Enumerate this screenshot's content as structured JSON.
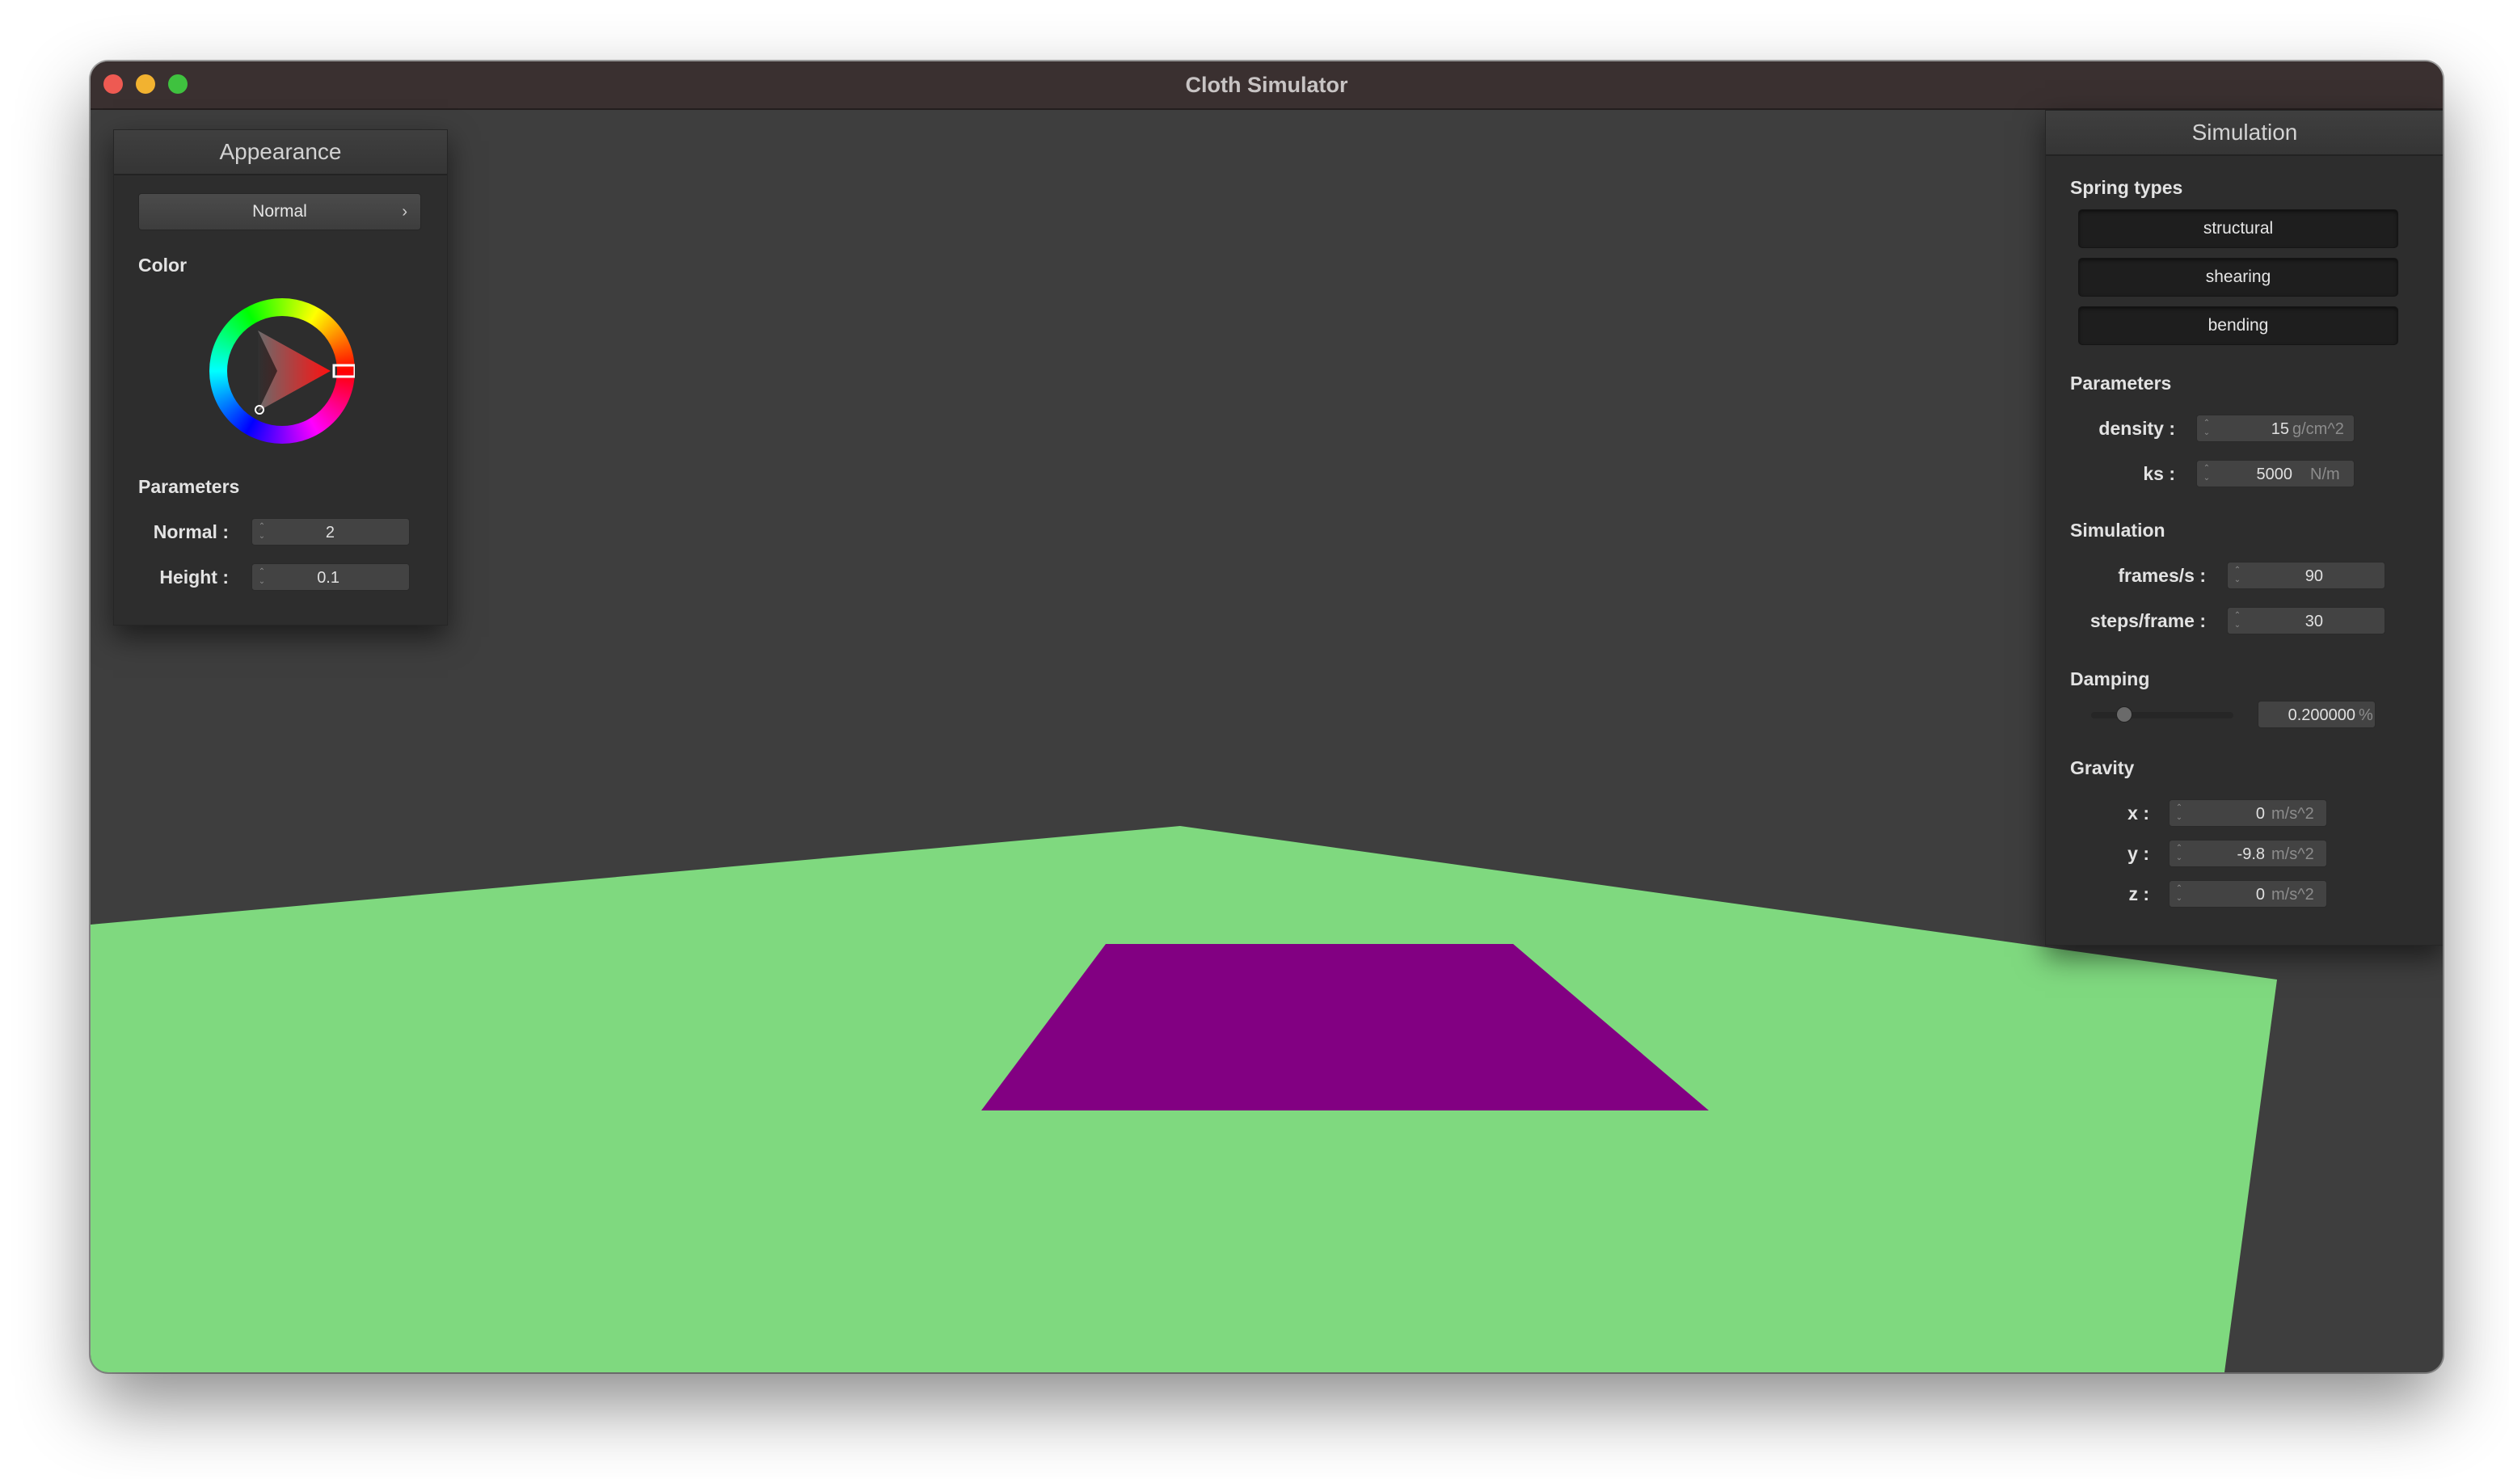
{
  "window": {
    "title": "Cloth Simulator"
  },
  "appearance": {
    "header": "Appearance",
    "shader_dropdown": "Normal",
    "color_label": "Color",
    "parameters_label": "Parameters",
    "normal": {
      "label": "Normal :",
      "value": "2"
    },
    "height": {
      "label": "Height :",
      "value": "0.1"
    }
  },
  "simulation": {
    "header": "Simulation",
    "spring_types_label": "Spring types",
    "spring_types": [
      "structural",
      "shearing",
      "bending"
    ],
    "parameters_label": "Parameters",
    "density": {
      "label": "density :",
      "value": "15",
      "unit": "g/cm^2"
    },
    "ks": {
      "label": "ks :",
      "value": "5000",
      "unit": "N/m"
    },
    "simulation_label": "Simulation",
    "frames_per_s": {
      "label": "frames/s :",
      "value": "90"
    },
    "steps_per_frame": {
      "label": "steps/frame :",
      "value": "30"
    },
    "damping_label": "Damping",
    "damping": {
      "value": "0.200000",
      "unit": "%",
      "slider_fraction": 0.2
    },
    "gravity_label": "Gravity",
    "gravity": {
      "x": {
        "label": "x :",
        "value": "0",
        "unit": "m/s^2"
      },
      "y": {
        "label": "y :",
        "value": "-9.8",
        "unit": "m/s^2"
      },
      "z": {
        "label": "z :",
        "value": "0",
        "unit": "m/s^2"
      }
    }
  },
  "scene": {
    "background": "#3e3e3e",
    "plane_color": "#7fd97f",
    "cloth_color": "#820082"
  }
}
